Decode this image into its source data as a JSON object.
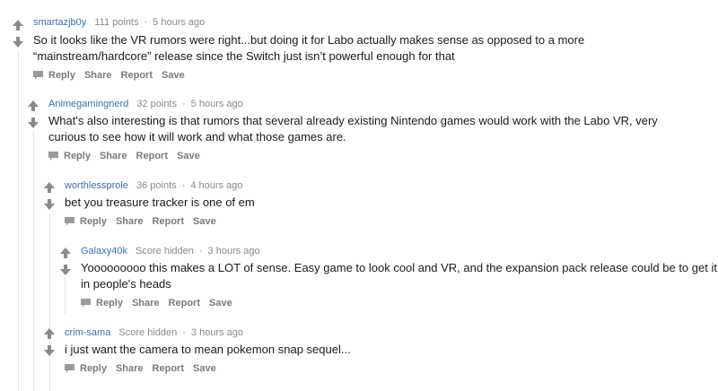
{
  "icons": {
    "upvote": "up-arrow-icon",
    "downvote": "down-arrow-icon",
    "reply": "comment-bubble-icon"
  },
  "colors": {
    "author": "#3771b3",
    "meta": "#878a8c",
    "arrow": "#8a8a8a",
    "action": "#7a7a7a"
  },
  "comments": [
    {
      "author": "smartazjb0y",
      "score": "111 points",
      "sep": "·",
      "time": "5 hours ago",
      "lines": [
        "So it looks like the VR rumors were right...but doing it for Labo actually makes sense as opposed to a more",
        "“mainstream/hardcore” release since the Switch just isn’t powerful enough for that"
      ],
      "actions": {
        "reply": "Reply",
        "share": "Share",
        "report": "Report",
        "save": "Save"
      }
    },
    {
      "author": "Animegamingnerd",
      "score": "32 points",
      "sep": "·",
      "time": "5 hours ago",
      "lines": [
        "What's also interesting is that rumors that several already existing Nintendo games would work with the Labo VR, very",
        "curious to see how it will work and what those games are."
      ],
      "actions": {
        "reply": "Reply",
        "share": "Share",
        "report": "Report",
        "save": "Save"
      }
    },
    {
      "author": "worthlessprole",
      "score": "36 points",
      "sep": "·",
      "time": "4 hours ago",
      "lines": [
        "bet you treasure tracker is one of em"
      ],
      "actions": {
        "reply": "Reply",
        "share": "Share",
        "report": "Report",
        "save": "Save"
      }
    },
    {
      "author": "Galaxy40k",
      "score": "Score hidden",
      "sep": "·",
      "time": "3 hours ago",
      "lines": [
        "Yooooooooo this makes a LOT of sense. Easy game to look cool and VR, and the expansion pack release could be to get it",
        "in people's heads"
      ],
      "actions": {
        "reply": "Reply",
        "share": "Share",
        "report": "Report",
        "save": "Save"
      }
    },
    {
      "author": "crim-sama",
      "score": "Score hidden",
      "sep": "·",
      "time": "3 hours ago",
      "lines": [
        "i just want the camera to mean pokemon snap sequel..."
      ],
      "actions": {
        "reply": "Reply",
        "share": "Share",
        "report": "Report",
        "save": "Save"
      }
    }
  ]
}
